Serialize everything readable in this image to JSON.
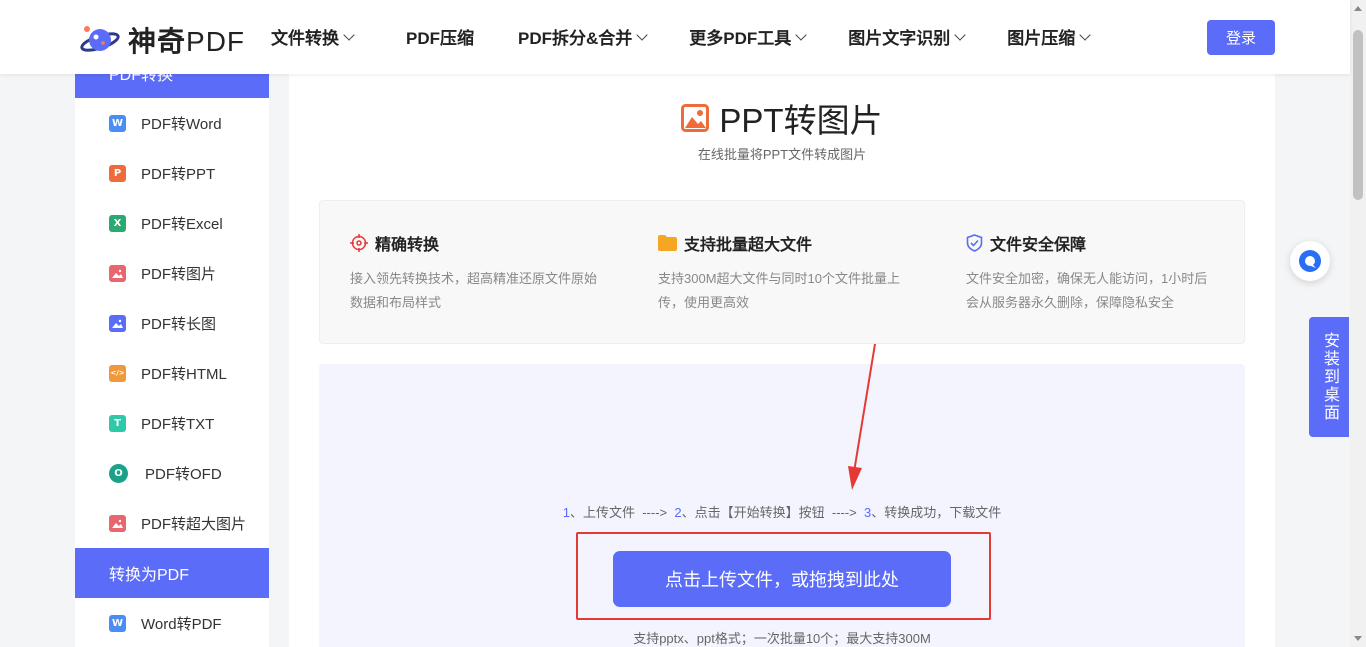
{
  "header": {
    "brand_cn": "神奇",
    "brand_en": "PDF",
    "nav": [
      {
        "label": "文件转换",
        "dropdown": true
      },
      {
        "label": "PDF压缩",
        "dropdown": false
      },
      {
        "label": "PDF拆分&合并",
        "dropdown": true
      },
      {
        "label": "更多PDF工具",
        "dropdown": true
      },
      {
        "label": "图片文字识别",
        "dropdown": true
      },
      {
        "label": "图片压缩",
        "dropdown": true
      }
    ],
    "login_label": "登录"
  },
  "sidebar": {
    "section1_title": "PDF转换",
    "items1": [
      {
        "label": "PDF转Word",
        "icon": "W",
        "color": "#4a8ef5"
      },
      {
        "label": "PDF转PPT",
        "icon": "P",
        "color": "#ef6b3a"
      },
      {
        "label": "PDF转Excel",
        "icon": "X",
        "color": "#2aa971"
      },
      {
        "label": "PDF转图片",
        "icon": "img",
        "color": "#e8666e"
      },
      {
        "label": "PDF转长图",
        "icon": "img",
        "color": "#5b6cf9"
      },
      {
        "label": "PDF转HTML",
        "icon": "</>",
        "color": "#ef9a3a"
      },
      {
        "label": "PDF转TXT",
        "icon": "T",
        "color": "#2fc9a8"
      },
      {
        "label": "PDF转OFD",
        "icon": "O",
        "color": "#1aa187"
      },
      {
        "label": "PDF转超大图片",
        "icon": "img",
        "color": "#e8666e"
      }
    ],
    "section2_title": "转换为PDF",
    "items2": [
      {
        "label": "Word转PDF",
        "icon": "W",
        "color": "#4a8ef5"
      }
    ]
  },
  "main": {
    "title": "PPT转图片",
    "subtitle": "在线批量将PPT文件转成图片",
    "features": [
      {
        "title": "精确转换",
        "desc": "接入领先转换技术，超高精准还原文件原始数据和布局样式",
        "icon": "target-icon"
      },
      {
        "title": "支持批量超大文件",
        "desc": "支持300M超大文件与同时10个文件批量上传，使用更高效",
        "icon": "folder-icon"
      },
      {
        "title": "文件安全保障",
        "desc": "文件安全加密，确保无人能访问，1小时后会从服务器永久删除，保障隐私安全",
        "icon": "shield-icon"
      }
    ],
    "steps": {
      "s1_num": "1",
      "s1_text": "、上传文件",
      "arrow": "---->",
      "s2_num": "2",
      "s2_text": "、点击【开始转换】按钮",
      "s3_num": "3",
      "s3_text": "、转换成功，下载文件"
    },
    "upload_label": "点击上传文件，或拖拽到此处",
    "formats": "支持pptx、ppt格式；一次批量10个；最大支持300M"
  },
  "float": {
    "install_label": "安装到桌面"
  },
  "colors": {
    "accent": "#5b6cf9",
    "annotation_red": "#e53935"
  }
}
